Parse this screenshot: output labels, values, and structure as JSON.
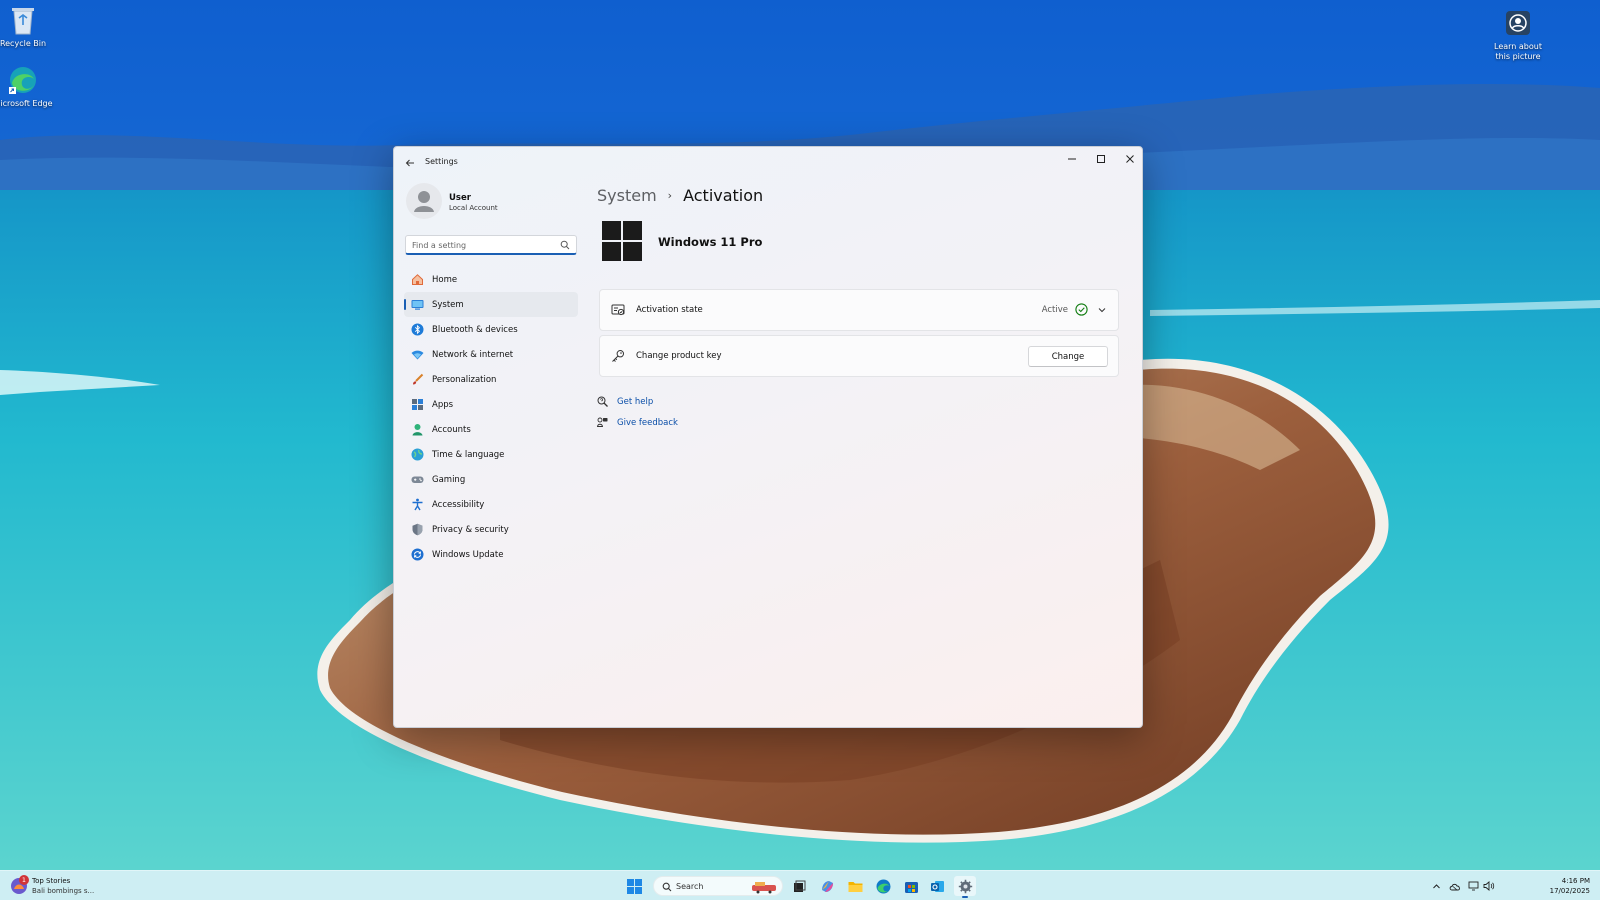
{
  "desktop": {
    "icons": [
      {
        "label": "Recycle Bin"
      },
      {
        "label": "Microsoft Edge"
      },
      {
        "label": "Learn about this picture"
      }
    ]
  },
  "window": {
    "title": "Settings",
    "user": {
      "name": "User",
      "account_type": "Local Account"
    },
    "search": {
      "placeholder": "Find a setting"
    },
    "nav": [
      {
        "label": "Home",
        "icon": "home-icon"
      },
      {
        "label": "System",
        "icon": "system-icon",
        "selected": true
      },
      {
        "label": "Bluetooth & devices",
        "icon": "bluetooth-icon"
      },
      {
        "label": "Network & internet",
        "icon": "network-icon"
      },
      {
        "label": "Personalization",
        "icon": "personalization-icon"
      },
      {
        "label": "Apps",
        "icon": "apps-icon"
      },
      {
        "label": "Accounts",
        "icon": "accounts-icon"
      },
      {
        "label": "Time & language",
        "icon": "time-language-icon"
      },
      {
        "label": "Gaming",
        "icon": "gaming-icon"
      },
      {
        "label": "Accessibility",
        "icon": "accessibility-icon"
      },
      {
        "label": "Privacy & security",
        "icon": "privacy-icon"
      },
      {
        "label": "Windows Update",
        "icon": "windows-update-icon"
      }
    ],
    "breadcrumb": {
      "parent": "System",
      "separator": "›",
      "current": "Activation"
    },
    "product": {
      "name": "Windows 11 Pro"
    },
    "activation": {
      "label": "Activation state",
      "status": "Active"
    },
    "product_key": {
      "label": "Change product key",
      "button": "Change"
    },
    "links": [
      {
        "label": "Get help"
      },
      {
        "label": "Give feedback"
      }
    ]
  },
  "taskbar": {
    "widget": {
      "title": "Top Stories",
      "subtitle": "Bali bombings s...",
      "badge": "1"
    },
    "search_label": "Search",
    "clock": {
      "time": "4:16 PM",
      "date": "17/02/2025"
    }
  },
  "colors": {
    "accent": "#1a5fb4",
    "link": "#0b4fa8",
    "success": "#107c10"
  }
}
